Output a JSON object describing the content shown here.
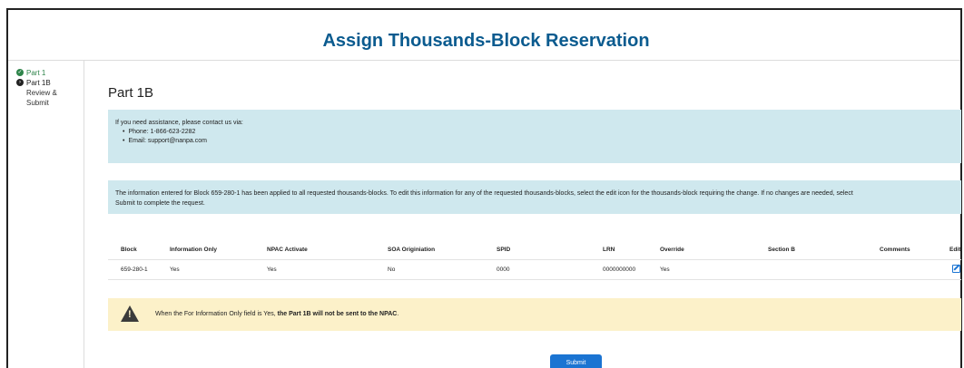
{
  "header": {
    "title": "Assign Thousands-Block Reservation"
  },
  "sidebar": {
    "items": [
      {
        "label": "Part 1",
        "state": "complete",
        "icon": "check-circle-icon"
      },
      {
        "label": "Part 1B",
        "state": "current",
        "icon": "arrow-circle-icon"
      },
      {
        "label": "Review &",
        "label2": "Submit",
        "state": "upcoming"
      }
    ]
  },
  "main": {
    "page_title": "Part 1B",
    "contact": {
      "intro": "If you need assistance, please contact us via:",
      "phone": "Phone: 1-866-623-2282",
      "email": "Email: support@nanpa.com"
    },
    "notice": {
      "line1": "The information entered for Block 659-280-1 has been applied to all requested thousands-blocks. To edit this information for any of the requested thousands-blocks, select the edit icon for the thousands-block requiring the change. If no changes are needed, select",
      "line2": "Submit to complete the request."
    },
    "table": {
      "headers": [
        "Block",
        "Information Only",
        "NPAC Activate",
        "SOA Originiation",
        "SPID",
        "LRN",
        "Override",
        "Section B",
        "Comments",
        "Edit"
      ],
      "rows": [
        {
          "block": "659-280-1",
          "information_only": "Yes",
          "npac_activate": "Yes",
          "soa_origination": "No",
          "spid": "0000",
          "lrn": "0000000000",
          "override": "Yes",
          "section_b": "",
          "comments": ""
        }
      ]
    },
    "warning": {
      "text_prefix": "When the For Information Only field is Yes,",
      "text_bold": " the Part 1B will not be sent to the NPAC",
      "text_suffix": "."
    },
    "submit_label": "Submit"
  },
  "colors": {
    "title": "#0b5b8f",
    "info_bg": "#cfe8ee",
    "warning_bg": "#fcf1c9",
    "primary_button": "#1b74d2",
    "complete_green": "#2e844a"
  }
}
